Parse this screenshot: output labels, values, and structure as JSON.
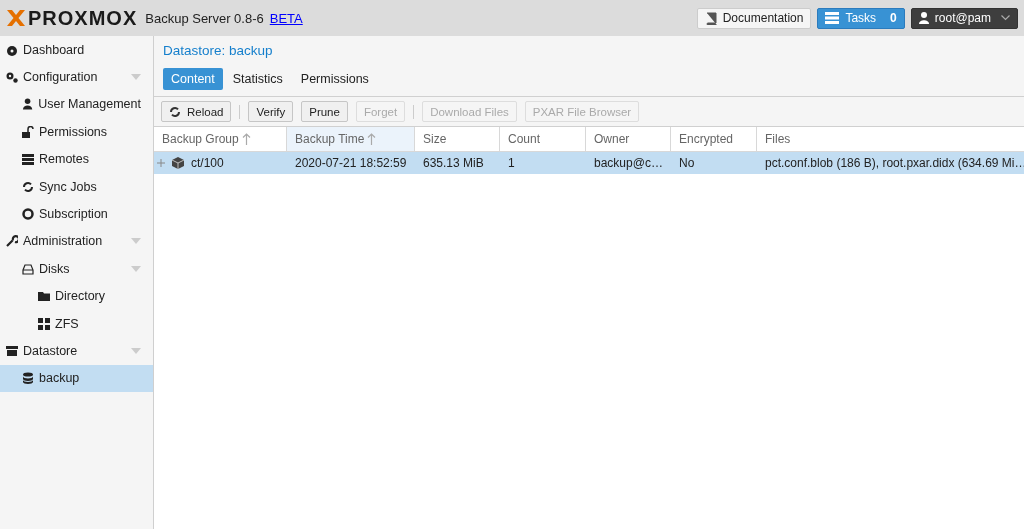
{
  "header": {
    "logo": "PROXMOX",
    "product": "Backup Server 0.8-6",
    "beta_link": "BETA",
    "documentation_button": "Documentation",
    "tasks_button": {
      "label": "Tasks",
      "count": "0"
    },
    "user_menu": "root@pam"
  },
  "sidebar": {
    "items": [
      {
        "label": "Dashboard",
        "selected": false
      },
      {
        "label": "Configuration",
        "selected": false,
        "expanded": true,
        "children": [
          {
            "label": "User Management",
            "selected": false
          },
          {
            "label": "Permissions",
            "selected": false
          },
          {
            "label": "Remotes",
            "selected": false
          },
          {
            "label": "Sync Jobs",
            "selected": false
          },
          {
            "label": "Subscription",
            "selected": false
          }
        ]
      },
      {
        "label": "Administration",
        "selected": false,
        "expanded": true,
        "children": [
          {
            "label": "Disks",
            "selected": false,
            "expanded": true,
            "children": [
              {
                "label": "Directory",
                "selected": false
              },
              {
                "label": "ZFS",
                "selected": false
              }
            ]
          }
        ]
      },
      {
        "label": "Datastore",
        "selected": false,
        "expanded": true,
        "children": [
          {
            "label": "backup",
            "selected": true
          }
        ]
      }
    ]
  },
  "panel": {
    "title": "Datastore: backup",
    "tabs": [
      {
        "label": "Content",
        "selected": true
      },
      {
        "label": "Statistics",
        "selected": false
      },
      {
        "label": "Permissions",
        "selected": false
      }
    ],
    "toolbar": [
      {
        "label": "Reload",
        "disabled": false
      },
      {
        "label": "Verify",
        "disabled": false
      },
      {
        "label": "Prune",
        "disabled": false
      },
      {
        "label": "Forget",
        "disabled": true
      },
      {
        "label": "Download Files",
        "disabled": true
      },
      {
        "label": "PXAR File Browser",
        "disabled": true
      }
    ],
    "table": {
      "columns": [
        {
          "label": "Backup Group",
          "sorted": true,
          "highlighted": false
        },
        {
          "label": "Backup Time",
          "sorted": true,
          "highlighted": true
        },
        {
          "label": "Size",
          "sorted": false,
          "highlighted": false
        },
        {
          "label": "Count",
          "sorted": false,
          "highlighted": false
        },
        {
          "label": "Owner",
          "sorted": false,
          "highlighted": false
        },
        {
          "label": "Encrypted",
          "sorted": false,
          "highlighted": false
        },
        {
          "label": "Files",
          "sorted": false,
          "highlighted": false
        }
      ],
      "rows": [
        {
          "selected": true,
          "expanded": false,
          "cells": [
            "ct/100",
            "2020-07-21 18:52:59",
            "635.13 MiB",
            "1",
            "backup@c…",
            "No",
            "pct.conf.blob (186 B), root.pxar.didx (634.69 Mi…"
          ]
        }
      ]
    }
  }
}
